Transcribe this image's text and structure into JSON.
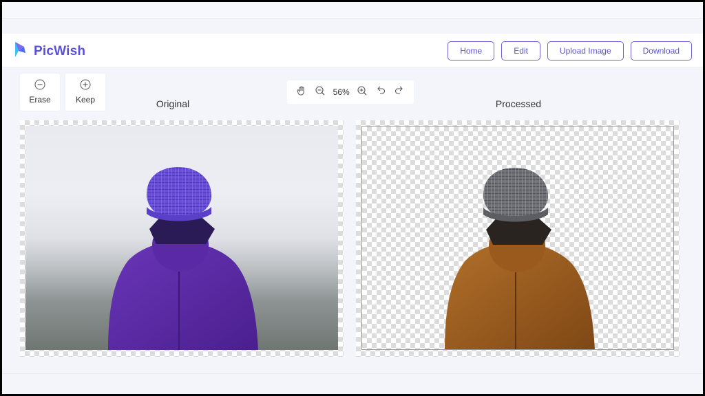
{
  "app": {
    "name": "PicWish",
    "brand_color": "#5a4fd8"
  },
  "nav": {
    "buttons": [
      {
        "label": "Home"
      },
      {
        "label": "Edit"
      },
      {
        "label": "Upload Image"
      },
      {
        "label": "Download"
      }
    ]
  },
  "tools": {
    "erase": {
      "label": "Erase",
      "icon": "minus-circle-icon"
    },
    "keep": {
      "label": "Keep",
      "icon": "plus-circle-icon"
    }
  },
  "zoom": {
    "value": "56%",
    "icons": [
      "hand-icon",
      "zoom-out-icon",
      "zoom-in-icon",
      "undo-icon",
      "redo-icon"
    ]
  },
  "panels": {
    "original": {
      "title": "Original"
    },
    "processed": {
      "title": "Processed"
    }
  },
  "colors": {
    "jacket_original": "#5a2aa6",
    "hat_original": "#6a4fd8",
    "jacket_processed": "#9a5a1e",
    "hat_processed": "#6e6f74"
  }
}
